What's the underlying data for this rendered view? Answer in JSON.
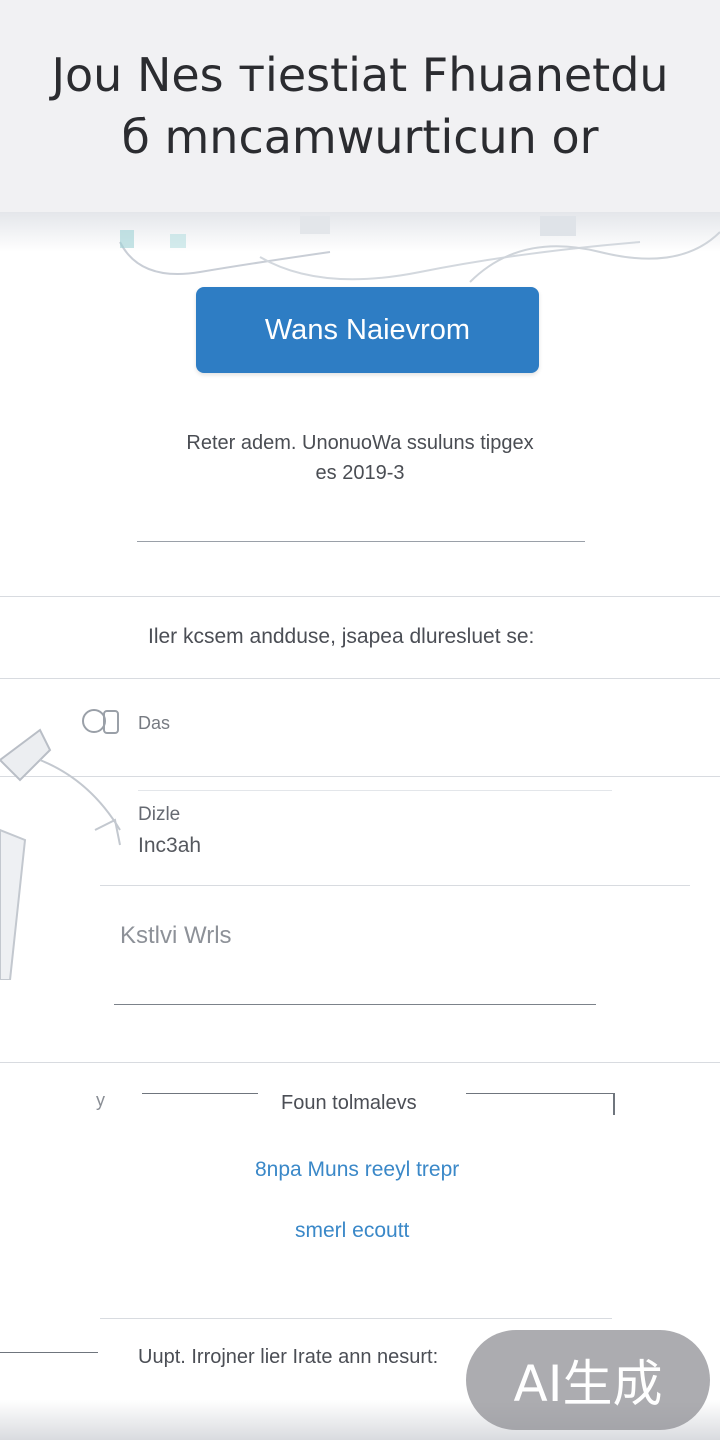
{
  "header": {
    "title_line1": "Jou Nes тiestiat Fhuanetdu",
    "title_line2": "б mncamwurticun or"
  },
  "primary_button": {
    "label": "Wans Naievrom"
  },
  "info": {
    "line1": "Reter adem. UnonuoWa ssuluns tipgex",
    "line2": "es 2019-3"
  },
  "rows": {
    "notice": "Iler kcsem andduse, jsapea dluresluet se:",
    "item_label": "Das"
  },
  "fields": {
    "field1_label": "Dizle",
    "field1_value": "Inc3ah",
    "field2_placeholder": "Kstlvi Wrls"
  },
  "divider": {
    "left_mark": "у",
    "label": "Foun  tolmalevs"
  },
  "links": {
    "link1": "8npa  Muns reeyl trepr",
    "link2": "smerl ecoutt"
  },
  "footer": {
    "text": "Uupt. Irrojner lier Irate  ann nesurt:"
  },
  "badge": {
    "text": "AI生成"
  },
  "colors": {
    "accent": "#2e7dc4",
    "link": "#3a88c8",
    "header_bg": "#f1f1f3"
  }
}
